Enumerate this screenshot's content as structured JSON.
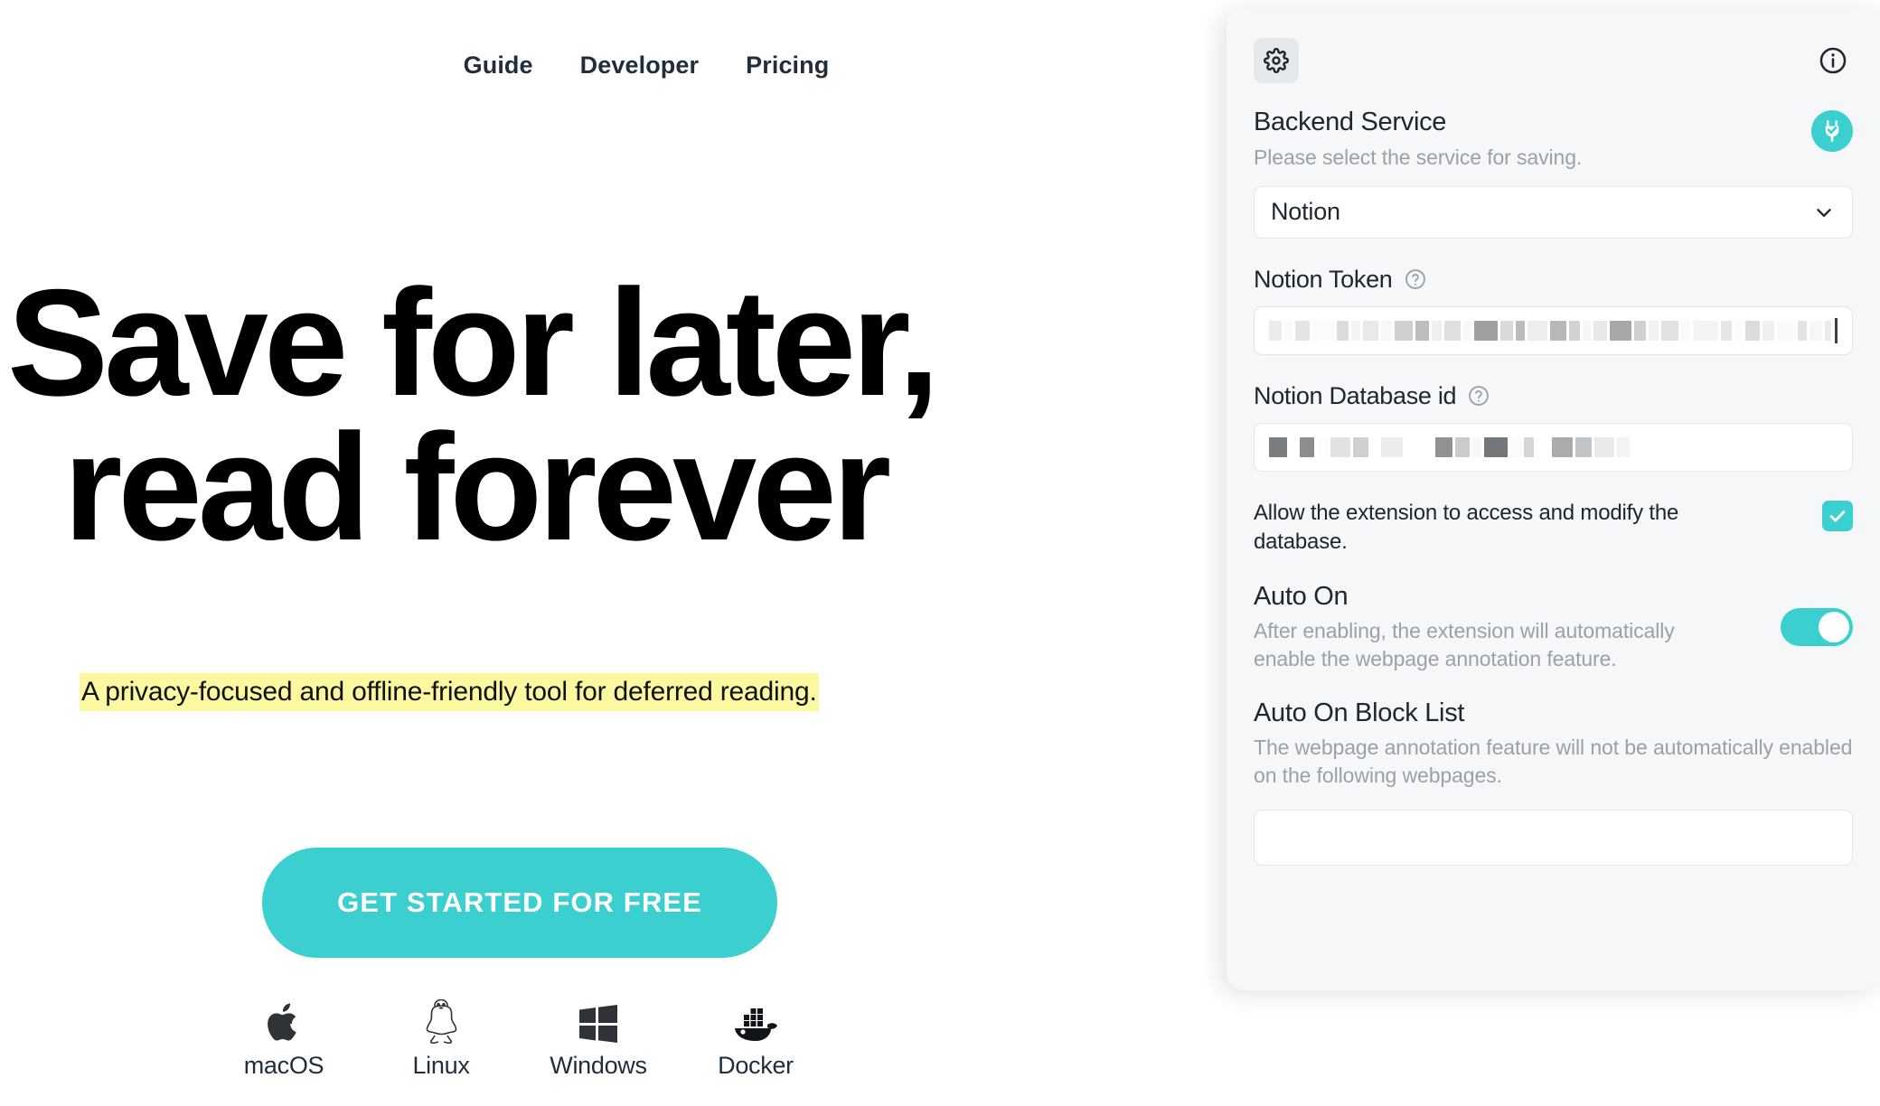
{
  "site": {
    "nav": [
      {
        "label": "Guide",
        "name": "nav-link-guide"
      },
      {
        "label": "Developer",
        "name": "nav-link-developer"
      },
      {
        "label": "Pricing",
        "name": "nav-link-pricing"
      }
    ],
    "hero": {
      "title_line1": "Save for later,",
      "title_line2": "read forever",
      "subtitle": "A privacy-focused and offline-friendly tool for deferred reading.",
      "subtitle_highlight_color": "#fbf8a0"
    },
    "cta": {
      "label": "GET STARTED FOR FREE",
      "color": "#3ccfcf"
    },
    "platforms": [
      {
        "label": "macOS",
        "icon": "apple-icon"
      },
      {
        "label": "Linux",
        "icon": "linux-penguin-icon"
      },
      {
        "label": "Windows",
        "icon": "windows-icon"
      },
      {
        "label": "Docker",
        "icon": "docker-whale-icon"
      }
    ]
  },
  "panel": {
    "topbar": {
      "settings_icon": "gear-icon",
      "info_icon": "info-circle-icon"
    },
    "backend_service": {
      "title": "Backend Service",
      "description": "Please select the service for saving.",
      "status_icon": "plug-check-icon",
      "status_color": "#3ccfcf",
      "selected": "Notion",
      "options": [
        "Notion"
      ]
    },
    "notion_token": {
      "label": "Notion Token",
      "help_icon": "question-circle-icon",
      "value_redacted": true,
      "placeholder": ""
    },
    "notion_database_id": {
      "label": "Notion Database id",
      "help_icon": "question-circle-icon",
      "value_redacted": true,
      "placeholder": ""
    },
    "allow_access": {
      "text": "Allow the extension to access and modify the database.",
      "checked": true,
      "check_color": "#3ccfcf"
    },
    "auto_on": {
      "title": "Auto On",
      "description": "After enabling, the extension will automatically enable the webpage annotation feature.",
      "enabled": true,
      "toggle_color": "#3ccfcf"
    },
    "auto_on_block_list": {
      "title": "Auto On Block List",
      "description": "The webpage annotation feature will not be automatically enabled on the following webpages.",
      "value": "",
      "placeholder": ""
    }
  }
}
